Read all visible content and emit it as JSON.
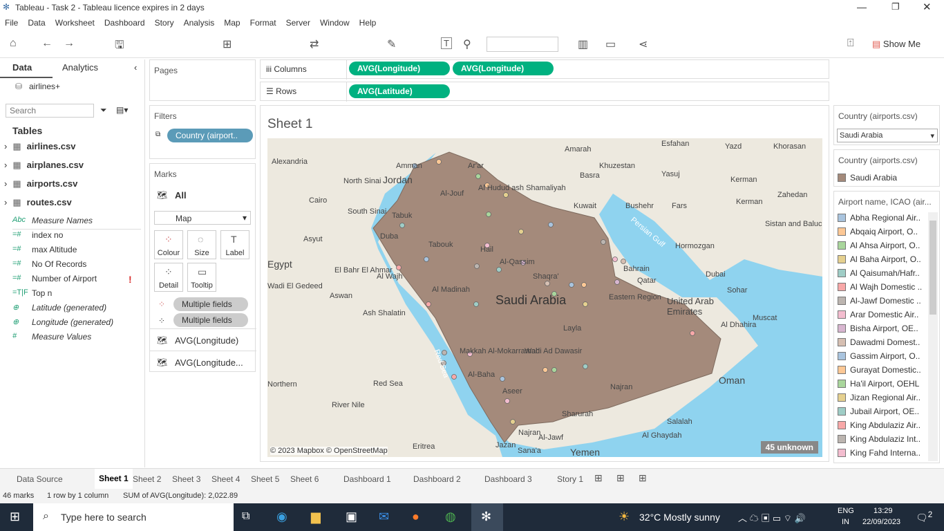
{
  "window": {
    "title": "Tableau - Task 2 - Tableau licence expires in 2 days"
  },
  "menu": [
    "File",
    "Data",
    "Worksheet",
    "Dashboard",
    "Story",
    "Analysis",
    "Map",
    "Format",
    "Server",
    "Window",
    "Help"
  ],
  "toolbar": {
    "show_me": "Show Me"
  },
  "left": {
    "tab_data": "Data",
    "tab_analytics": "Analytics",
    "datasource": "airlines+",
    "search_placeholder": "Search",
    "tables_heading": "Tables",
    "tables": [
      "airlines.csv",
      "airplanes.csv",
      "airports.csv",
      "routes.csv"
    ],
    "fields": [
      {
        "icon": "Abc",
        "name": "Measure Names"
      },
      {
        "icon": "=#",
        "name": "index no"
      },
      {
        "icon": "=#",
        "name": "max Altitude"
      },
      {
        "icon": "=#",
        "name": "No Of Records"
      },
      {
        "icon": "=#",
        "name": "Number of Airport"
      },
      {
        "icon": "=T|F",
        "name": "Top n"
      },
      {
        "icon": "globe",
        "name": "Latitude (generated)"
      },
      {
        "icon": "globe",
        "name": "Longitude (generated)"
      },
      {
        "icon": "#",
        "name": "Measure Values"
      }
    ],
    "warning": "!"
  },
  "pages": {
    "label": "Pages"
  },
  "filters": {
    "label": "Filters",
    "pill": "Country (airport.."
  },
  "marks": {
    "label": "Marks",
    "all": "All",
    "type": "Map",
    "buttons": [
      "Colour",
      "Size",
      "Label",
      "Detail",
      "Tooltip"
    ],
    "fields": [
      "Multiple fields",
      "Multiple fields"
    ],
    "layers": [
      "AVG(Longitude)",
      "AVG(Longitude..."
    ]
  },
  "shelves": {
    "columns_label": "Columns",
    "rows_label": "Rows",
    "columns": [
      "AVG(Longitude)",
      "AVG(Longitude)"
    ],
    "rows": [
      "AVG(Latitude)"
    ]
  },
  "sheet": {
    "title": "Sheet 1",
    "attribution": "© 2023 Mapbox © OpenStreetMap",
    "unknown": "45 unknown",
    "country_fill": "#a48a7b",
    "ocean": "#8fd3ef",
    "land": "#ede9df"
  },
  "map": {
    "labels": [
      "Amman",
      "Amarah",
      "Esfahan",
      "Yazd",
      "Khorasan",
      "Alexandria",
      "Jordan",
      "Ar'ar",
      "Khuzestan",
      "Yasuj",
      "North Sinai",
      "Al Hudud ash Shamaliyah",
      "Basra",
      "Kerman",
      "Cairo",
      "Al-Jouf",
      "Kuwait",
      "Bushehr",
      "Fars",
      "Kerman",
      "Zahedan",
      "South Sinai",
      "Tabuk",
      "Sistan and Baluchestan",
      "Asyut",
      "Duba",
      "Tabouk",
      "Hail",
      "Hormozgan",
      "Egypt",
      "El Bahr El Ahmar",
      "Al Wajh",
      "Al-Qassim",
      "Bahrain",
      "Qatar",
      "Shaqra'",
      "Dubai",
      "Sohar",
      "Wadi El Gedeed",
      "Aswan",
      "Al Madinah",
      "Saudi Arabia",
      "Eastern Region",
      "United Arab Emirates",
      "Muscat",
      "Ash Shalatin",
      "Layla",
      "Al Dhahira",
      "Makkah Al-Mokarramah",
      "Wadi Ad Dawasir",
      "Oman",
      "Northern",
      "Red Sea",
      "Al-Baha",
      "River Nile",
      "Aseer",
      "Najran",
      "Najran",
      "Sharurah",
      "Salalah",
      "Jazan",
      "Al-Jawf",
      "Al Ghaydah",
      "Eritrea",
      "Sana'a",
      "Yemen",
      "Persian Gulf",
      "Red Sea"
    ]
  },
  "right": {
    "filter_title": "Country (airports.csv)",
    "filter_value": "Saudi Arabia",
    "legend1_title": "Country (airports.csv)",
    "legend1_item": "Saudi Arabia",
    "legend2_title": "Airport name, ICAO (air...",
    "airports": [
      {
        "name": "Abha Regional Air..",
        "color": "#a9c4de"
      },
      {
        "name": "Abqaiq Airport, O..",
        "color": "#fdc895"
      },
      {
        "name": "Al Ahsa Airport, O..",
        "color": "#a9d69c"
      },
      {
        "name": "Al Baha Airport, O..",
        "color": "#e5d08f"
      },
      {
        "name": "Al Qaisumah/Hafr..",
        "color": "#9fcdc6"
      },
      {
        "name": "Al Wajh Domestic ..",
        "color": "#f8a8a8"
      },
      {
        "name": "Al-Jawf Domestic ..",
        "color": "#bcb5b0"
      },
      {
        "name": "Arar Domestic Air..",
        "color": "#f3bdcf"
      },
      {
        "name": "Bisha Airport, OE..",
        "color": "#d8b6d0"
      },
      {
        "name": "Dawadmi Domest..",
        "color": "#d6bfb2"
      },
      {
        "name": "Gassim Airport, O..",
        "color": "#a9c4de"
      },
      {
        "name": "Gurayat Domestic..",
        "color": "#fdc895"
      },
      {
        "name": "Ha'il Airport, OEHL",
        "color": "#a9d69c"
      },
      {
        "name": "Jizan Regional Air..",
        "color": "#e5d08f"
      },
      {
        "name": "Jubail Airport, OE..",
        "color": "#9fcdc6"
      },
      {
        "name": "King Abdulaziz Air..",
        "color": "#f8a8a8"
      },
      {
        "name": "King Abdulaziz Int..",
        "color": "#bcb5b0"
      },
      {
        "name": "King Fahd Interna..",
        "color": "#f3bdcf"
      }
    ]
  },
  "sheet_tabs": [
    "Data Source",
    "Sheet 1",
    "Sheet 2",
    "Sheet 3",
    "Sheet 4",
    "Sheet 5",
    "Sheet 6",
    "Dashboard 1",
    "Dashboard 2",
    "Dashboard 3",
    "Story 1"
  ],
  "status": {
    "marks": "46 marks",
    "rows": "1 row by 1 column",
    "sum": "SUM of AVG(Longitude): 2,022.89"
  },
  "taskbar": {
    "search": "Type here to search",
    "weather": "32°C  Mostly sunny",
    "lang1": "ENG",
    "lang2": "IN",
    "time": "13:29",
    "date": "22/09/2023",
    "notif": "2"
  }
}
